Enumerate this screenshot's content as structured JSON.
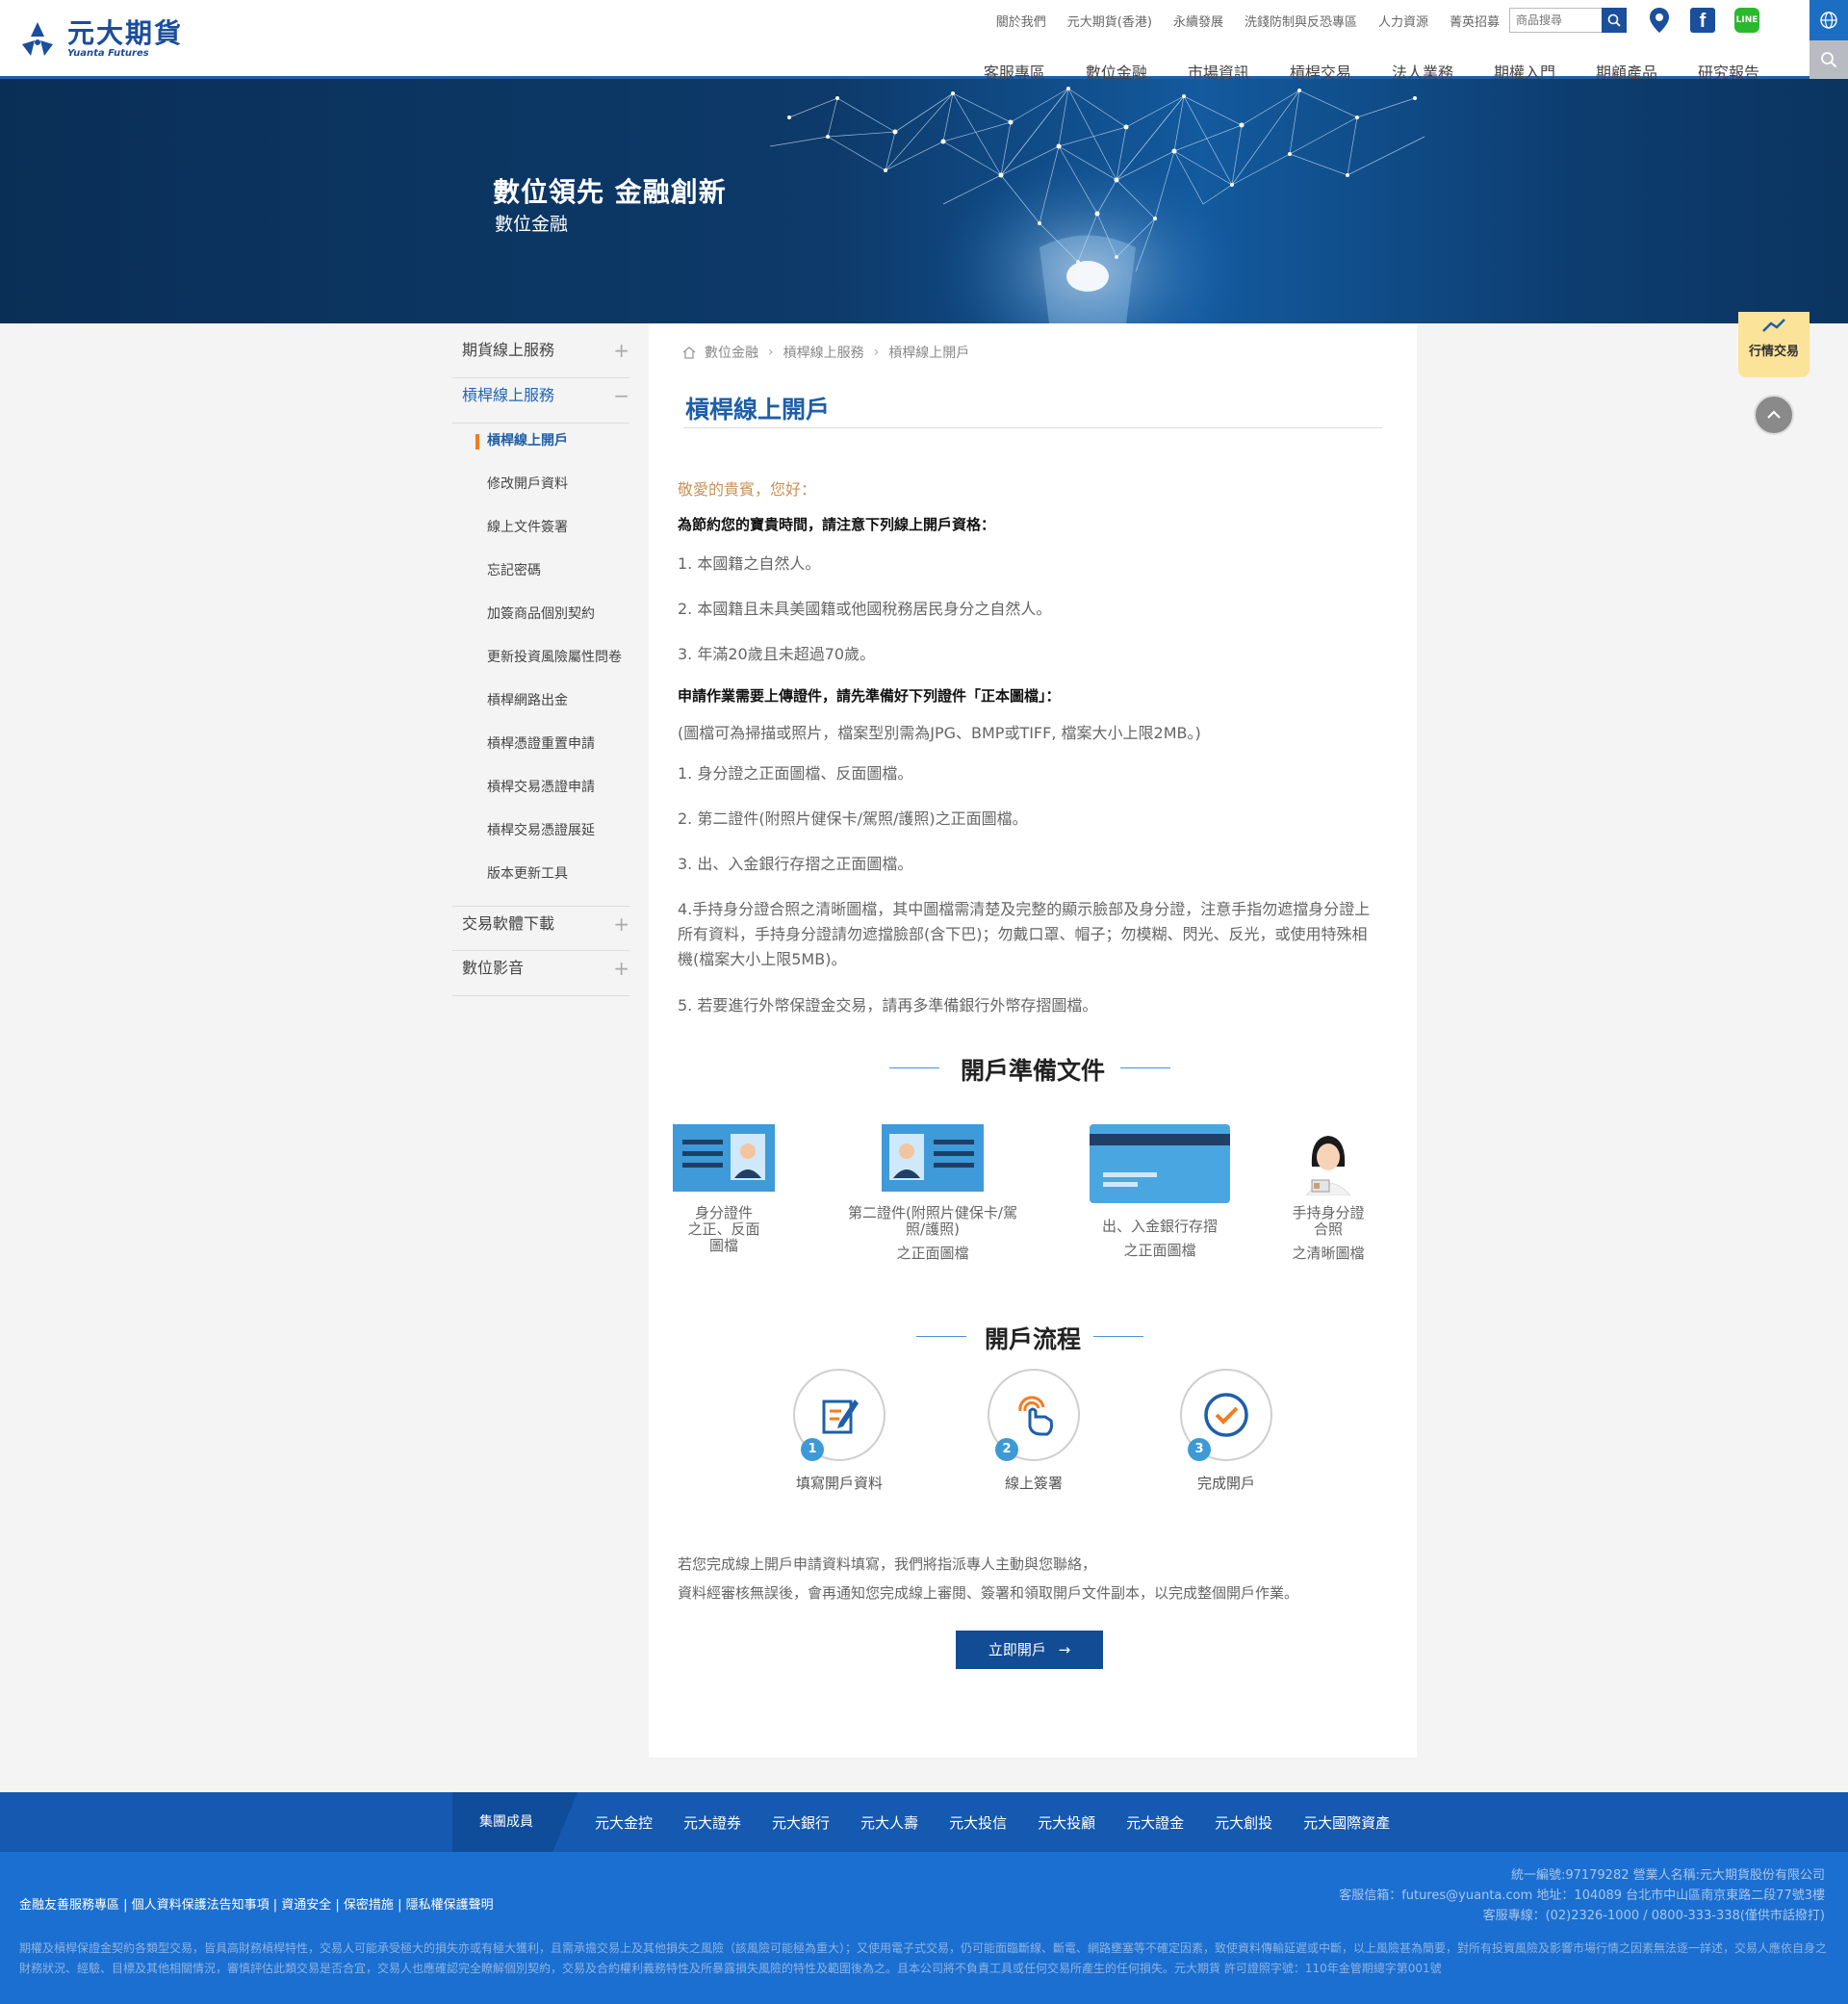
{
  "header": {
    "logo_cn": "元大期貨",
    "logo_en": "Yuanta Futures",
    "top_links": [
      "關於我們",
      "元大期貨(香港)",
      "永續發展",
      "洗錢防制與反恐專區",
      "人力資源",
      "菁英招募"
    ],
    "search_placeholder": "商品搜尋",
    "main_nav": [
      "客服專區",
      "數位金融",
      "市場資訊",
      "槓桿交易",
      "法人業務",
      "期權入門",
      "期顧產品",
      "研究報告"
    ]
  },
  "banner": {
    "title": "數位領先  金融創新",
    "subtitle": "數位金融"
  },
  "sidebar": {
    "items": [
      {
        "label": "期貨線上服務",
        "toggle": "+"
      },
      {
        "label": "槓桿線上服務",
        "toggle": "−"
      }
    ],
    "sub_items": [
      "槓桿線上開戶",
      "修改開戶資料",
      "線上文件簽署",
      "忘記密碼",
      "加簽商品個別契約",
      "更新投資風險屬性問卷",
      "槓桿網路出金",
      "槓桿憑證重置申請",
      "槓桿交易憑證申請",
      "槓桿交易憑證展延",
      "版本更新工具"
    ],
    "bottom_items": [
      {
        "label": "交易軟體下載",
        "toggle": "+"
      },
      {
        "label": "數位影音",
        "toggle": "+"
      }
    ]
  },
  "breadcrumb": [
    "數位金融",
    "槓桿線上服務",
    "槓桿線上開戶"
  ],
  "page_title": "槓桿線上開戶",
  "content": {
    "greeting": "敬愛的貴賓，您好：",
    "qual_heading": "為節約您的寶貴時間，請注意下列線上開戶資格：",
    "qualifications": [
      "1. 本國籍之自然人。",
      "2. 本國籍且未具美國籍或他國稅務居民身分之自然人。",
      "3. 年滿20歲且未超過70歲。"
    ],
    "docs_heading": "申請作業需要上傳證件，請先準備好下列證件「正本圖檔」：",
    "docs_note": "(圖檔可為掃描或照片，檔案型別需為JPG、BMP或TIFF, 檔案大小上限2MB。)",
    "docs": [
      "1. 身分證之正面圖檔、反面圖檔。",
      "2. 第二證件(附照片健保卡/駕照/護照)之正面圖檔。",
      "3. 出、入金銀行存摺之正面圖檔。",
      "4.手持身分證合照之清晰圖檔，其中圖檔需清楚及完整的顯示臉部及身分證，注意手指勿遮擋身分證上所有資料，手持身分證請勿遮擋臉部(含下巴)；勿戴口罩、帽子；勿模糊、閃光、反光，或使用特殊相機(檔案大小上限5MB)。",
      "5. 若要進行外幣保證金交易，請再多準備銀行外幣存摺圖檔。"
    ],
    "prep_title": "開戶準備文件",
    "prep_items": [
      {
        "line1": "身分證件",
        "line2": "之正、反面",
        "line3": "圖檔"
      },
      {
        "line1": "第二證件(附照片健保卡/駕",
        "line2": "照/護照)",
        "line3": "之正面圖檔"
      },
      {
        "line1": "出、入金銀行存摺",
        "line2": "",
        "line3": "之正面圖檔"
      },
      {
        "line1": "手持身分證",
        "line2": "合照",
        "line3": "之清晰圖檔"
      }
    ],
    "flow_title": "開戶流程",
    "steps": [
      {
        "num": "1",
        "label": "填寫開戶資料"
      },
      {
        "num": "2",
        "label": "線上簽署"
      },
      {
        "num": "3",
        "label": "完成開戶"
      }
    ],
    "closing_1": "若您完成線上開戶申請資料填寫，我們將指派專人主動與您聯絡，",
    "closing_2": "資料經審核無誤後，會再通知您完成線上審閱、簽署和領取開戶文件副本，以完成整個開戶作業。",
    "cta_label": "立即開戶"
  },
  "floating": {
    "trade_label": "行情交易"
  },
  "footer": {
    "group_label": "集團成員",
    "group_links": [
      "元大金控",
      "元大證券",
      "元大銀行",
      "元大人壽",
      "元大投信",
      "元大投顧",
      "元大證金",
      "元大創投",
      "元大國際資產"
    ],
    "policy_links": "金融友善服務專區 | 個人資料保護法告知事項 | 資通安全 | 保密措施 | 隱私權保護聲明",
    "right_1": "統一編號:97179282  營業人名稱:元大期貨股份有限公司",
    "right_2": "客服信箱：futures@yuanta.com  地址：104089 台北市中山區南京東路二段77號3樓",
    "right_3": "客服專線：(02)2326-1000 / 0800-333-338(僅供市話撥打)",
    "disclaimer": "期權及槓桿保證金契約各類型交易，皆具高財務槓桿特性，交易人可能承受極大的損失亦或有極大獲利，且需承擔交易上及其他損失之風險（該風險可能極為重大）；又使用電子式交易，仍可能面臨斷線、斷電、網路壅塞等不確定因素，致使資料傳輸延遲或中斷，以上風險甚為簡要，對所有投資風險及影響市場行情之因素無法逐一詳述，交易人應依自身之財務狀況、經驗、目標及其他相關情況，審慎評估此類交易是否合宜，交易人也應確認完全瞭解個別契約，交易及合約權利義務特性及所暴露損失風險的特性及範圍後為之。且本公司將不負責工具或任何交易所產生的任何損失。元大期貨 許可證照字號：110年金管期總字第001號"
  }
}
